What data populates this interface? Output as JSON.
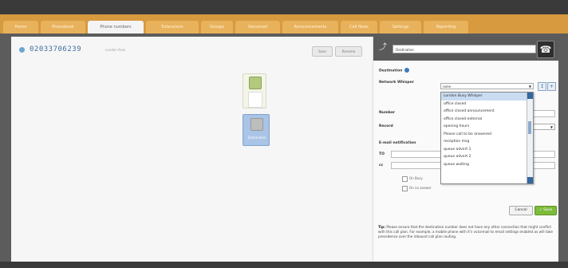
{
  "tabs": [
    {
      "label": "Home"
    },
    {
      "label": "Phonebook"
    },
    {
      "label": "Phone numbers",
      "active": true
    },
    {
      "label": "Extensions"
    },
    {
      "label": "Groups"
    },
    {
      "label": "Voicemail"
    },
    {
      "label": "Announcements"
    },
    {
      "label": "Call flows"
    },
    {
      "label": "Settings"
    },
    {
      "label": "Reporting"
    }
  ],
  "number": {
    "phone": "02033706239",
    "location": "London Area",
    "btn_save": "Save",
    "btn_rename": "Rename"
  },
  "flow": {
    "destination_label": "Destination"
  },
  "panel": {
    "destination_input": "Destination",
    "destination_heading": "Destination",
    "network_whisper_label": "Network Whisper",
    "network_whisper_value": "none",
    "number_label": "Number",
    "record_label": "Record",
    "email_notification_label": "E-mail notification",
    "to_label": "TO",
    "cc_label": "cc",
    "on_busy_label": "On Busy",
    "no_answer_label": "On no answer",
    "cancel_label": "Cancel",
    "save_label": "Save",
    "tip_bold": "Tip:",
    "tip_text": "Please ensure that the destination number does not have any other connection that might conflict with this call plan. For example, a mobile phone with it's voicemail to email settings enabled as will take precedence over the inbound call plan routing."
  },
  "dropdown": {
    "items": [
      "London Busy Whisper",
      "office closed",
      "office closed announcement",
      "office closed external",
      "opening hours",
      "Please call to be answered",
      "reception msg",
      "queue advert 1",
      "queue advert 2",
      "queue waiting"
    ],
    "selected_index": 0
  },
  "colors": {
    "tab_bar": "#d79a3f",
    "accent_blue": "#3b7bbf",
    "save_green": "#7dbb3a"
  }
}
